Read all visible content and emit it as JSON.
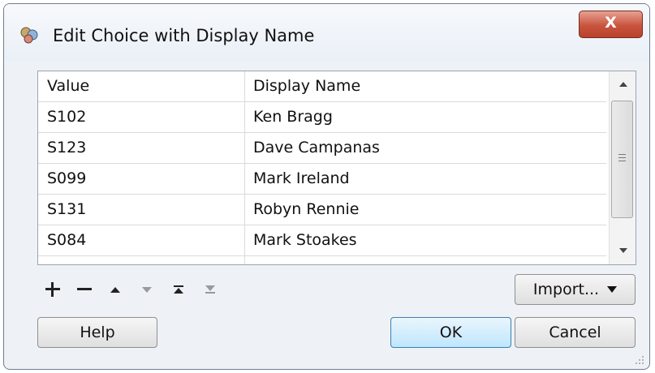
{
  "window": {
    "title": "Edit Choice with Display Name",
    "close_label": "X"
  },
  "table": {
    "columns": [
      "Value",
      "Display Name"
    ],
    "rows": [
      [
        "S102",
        "Ken Bragg"
      ],
      [
        "S123",
        "Dave Campanas"
      ],
      [
        "S099",
        "Mark Ireland"
      ],
      [
        "S131",
        "Robyn Rennie"
      ],
      [
        "S084",
        "Mark Stoakes"
      ]
    ]
  },
  "toolbar": {
    "icons": [
      "plus-icon",
      "minus-icon",
      "move-up-icon",
      "move-down-icon",
      "move-top-icon",
      "move-bottom-icon"
    ],
    "import_label": "Import..."
  },
  "buttons": {
    "help": "Help",
    "ok": "OK",
    "cancel": "Cancel"
  },
  "colors": {
    "close_button": "#c9543e",
    "ok_button": "#bee6fd",
    "disabled_icon": "#9a9a9a"
  }
}
